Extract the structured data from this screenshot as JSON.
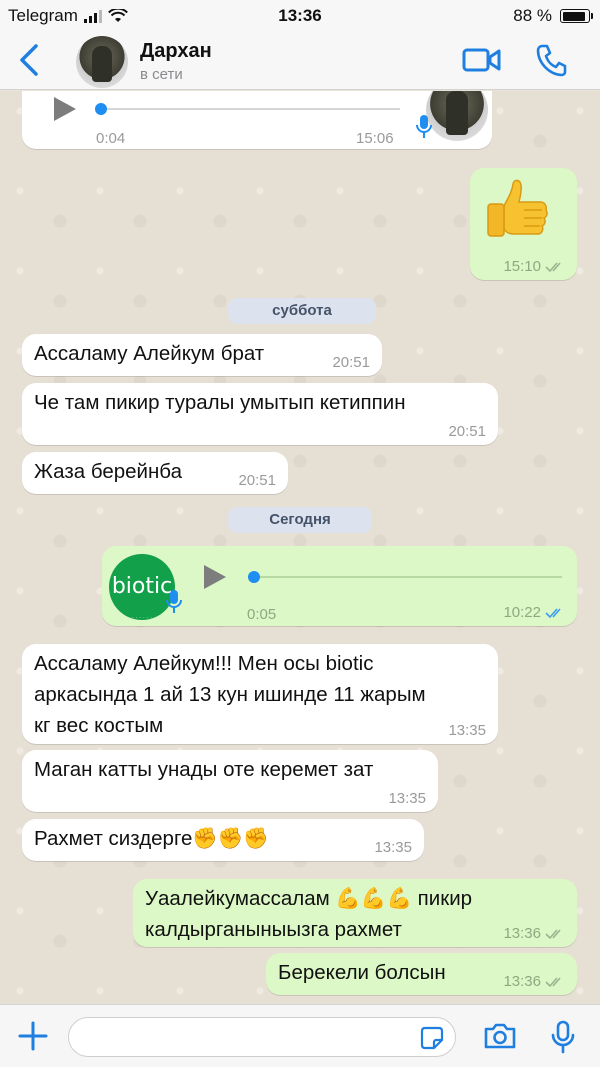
{
  "status_bar": {
    "carrier": "Telegram",
    "time": "13:36",
    "battery": "88 %",
    "battery_level": 0.88
  },
  "header": {
    "contact_name": "Дархан",
    "contact_status": "в сети",
    "back_icon": "chevron-left-icon",
    "video_icon": "video-camera-icon",
    "call_icon": "phone-icon"
  },
  "chat": {
    "voice_1": {
      "duration": "0:04",
      "time": "15:06"
    },
    "thumbs_up": {
      "emoji": "👍",
      "time": "15:10"
    },
    "date_saturday": "суббота",
    "msg_1": {
      "text": "Ассаламу Алейкум брат",
      "time": "20:51"
    },
    "msg_2": {
      "text": "Че там пикир туралы умытып кетиппин",
      "time": "20:51"
    },
    "msg_3": {
      "text": "Жаза берейнба",
      "time": "20:51"
    },
    "date_today": "Сегодня",
    "voice_2": {
      "logo_text": "biotic",
      "duration": "0:05",
      "time": "10:22"
    },
    "msg_4": {
      "line1": "Ассаламу Алейкум!!! Мен осы biotic",
      "line2": "аркасында 1 ай 13 кун ишинде 11 жарым",
      "line3": "кг вес костым",
      "time": "13:35"
    },
    "msg_5": {
      "text": "Маган катты унады оте керемет зат",
      "time": "13:35"
    },
    "msg_6": {
      "text": "Рахмет сиздерге✊✊✊",
      "time": "13:35"
    },
    "msg_7": {
      "line1": "Уаалейкумассалам 💪💪💪 пикир",
      "line2": "калдырганыныызга рахмет",
      "time": "13:36"
    },
    "msg_8": {
      "text": "Берекели болсын",
      "time": "13:36"
    }
  },
  "input_bar": {
    "placeholder": "",
    "value": ""
  },
  "colors": {
    "accent": "#1f7fe0",
    "incoming_bubble": "#ffffff",
    "outgoing_bubble": "#dcf8c6",
    "read_ticks": "#3d9df0"
  }
}
